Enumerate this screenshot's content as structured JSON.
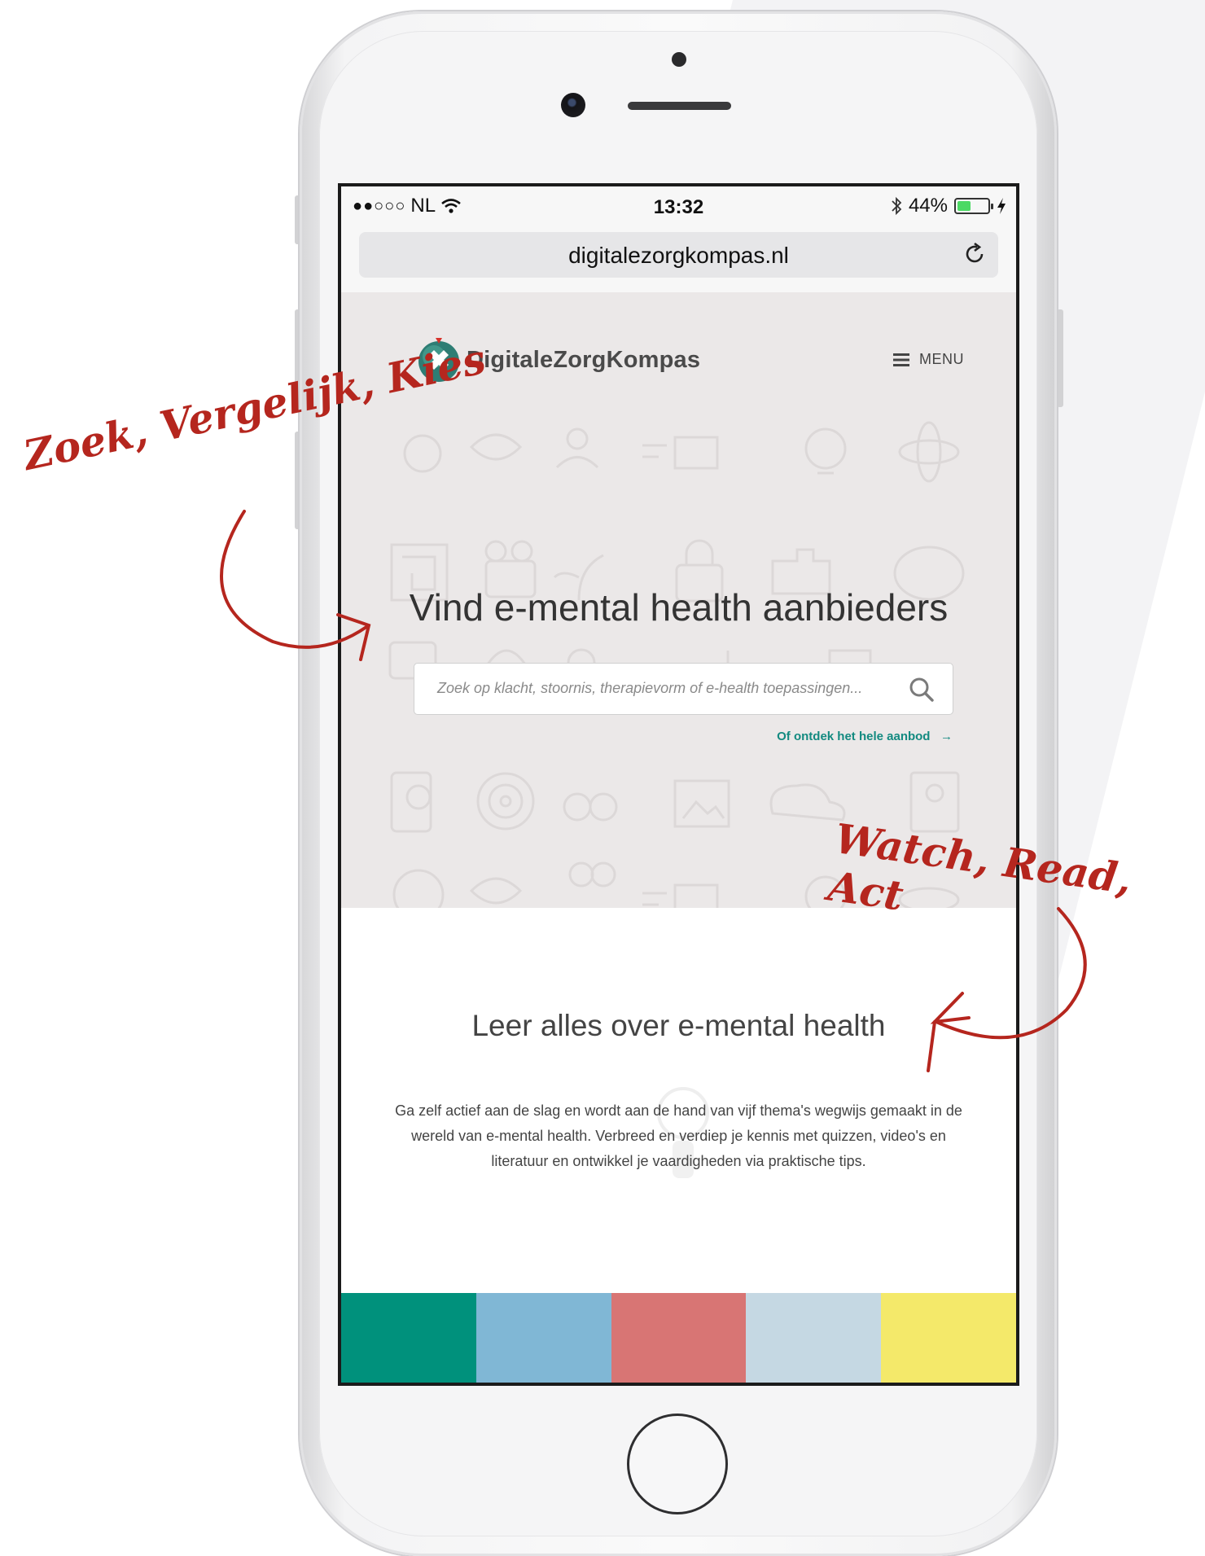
{
  "annotations": {
    "left": "Zoek, Vergelijk, Kies",
    "right": "Watch, Read, Act"
  },
  "status_bar": {
    "carrier": "NL",
    "time": "13:32",
    "battery": "44%",
    "battery_level": 0.44
  },
  "browser": {
    "url": "digitalezorgkompas.nl"
  },
  "site": {
    "logo_text": "DigitaleZorgKompas",
    "menu_label": "MENU"
  },
  "hero": {
    "title": "Vind e-mental health aanbieders",
    "search_placeholder": "Zoek op klacht, stoornis, therapievorm of e-health toepassingen...",
    "discover_link": "Of ontdek het hele aanbod"
  },
  "learn": {
    "title": "Leer alles over e-mental health",
    "body": "Ga zelf actief aan de slag en wordt aan de hand van vijf thema's wegwijs gemaakt in de wereld van e-mental health. Verbreed en verdiep je kennis met quizzen, video's en literatuur en ontwikkel je vaardigheden via praktische tips."
  },
  "theme_colors": [
    "#00917c",
    "#80b7d5",
    "#d87574",
    "#c5d8e3",
    "#f4e96a"
  ]
}
